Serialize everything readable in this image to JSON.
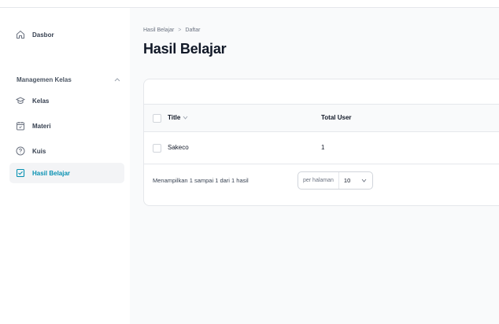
{
  "sidebar": {
    "dashboard_label": "Dasbor",
    "group_label": "Managemen Kelas",
    "items": [
      {
        "label": "Kelas",
        "icon": "graduation-cap-icon"
      },
      {
        "label": "Materi",
        "icon": "calendar-icon"
      },
      {
        "label": "Kuis",
        "icon": "question-circle-icon"
      },
      {
        "label": "Hasil Belajar",
        "icon": "clipboard-check-icon",
        "active": true
      }
    ]
  },
  "breadcrumb": {
    "parent": "Hasil Belajar",
    "separator": ">",
    "current": "Daftar"
  },
  "page_title": "Hasil Belajar",
  "table": {
    "columns": {
      "title": "Title",
      "total_user": "Total User"
    },
    "rows": [
      {
        "title": "Sakeco",
        "total_user": "1"
      }
    ]
  },
  "pagination": {
    "summary": "Menampilkan 1 sampai 1 dari 1 hasil",
    "per_page_label": "per halaman",
    "per_page_value": "10"
  },
  "colors": {
    "accent": "#0891b2",
    "background": "#f9fafb",
    "border": "#e5e7eb"
  }
}
